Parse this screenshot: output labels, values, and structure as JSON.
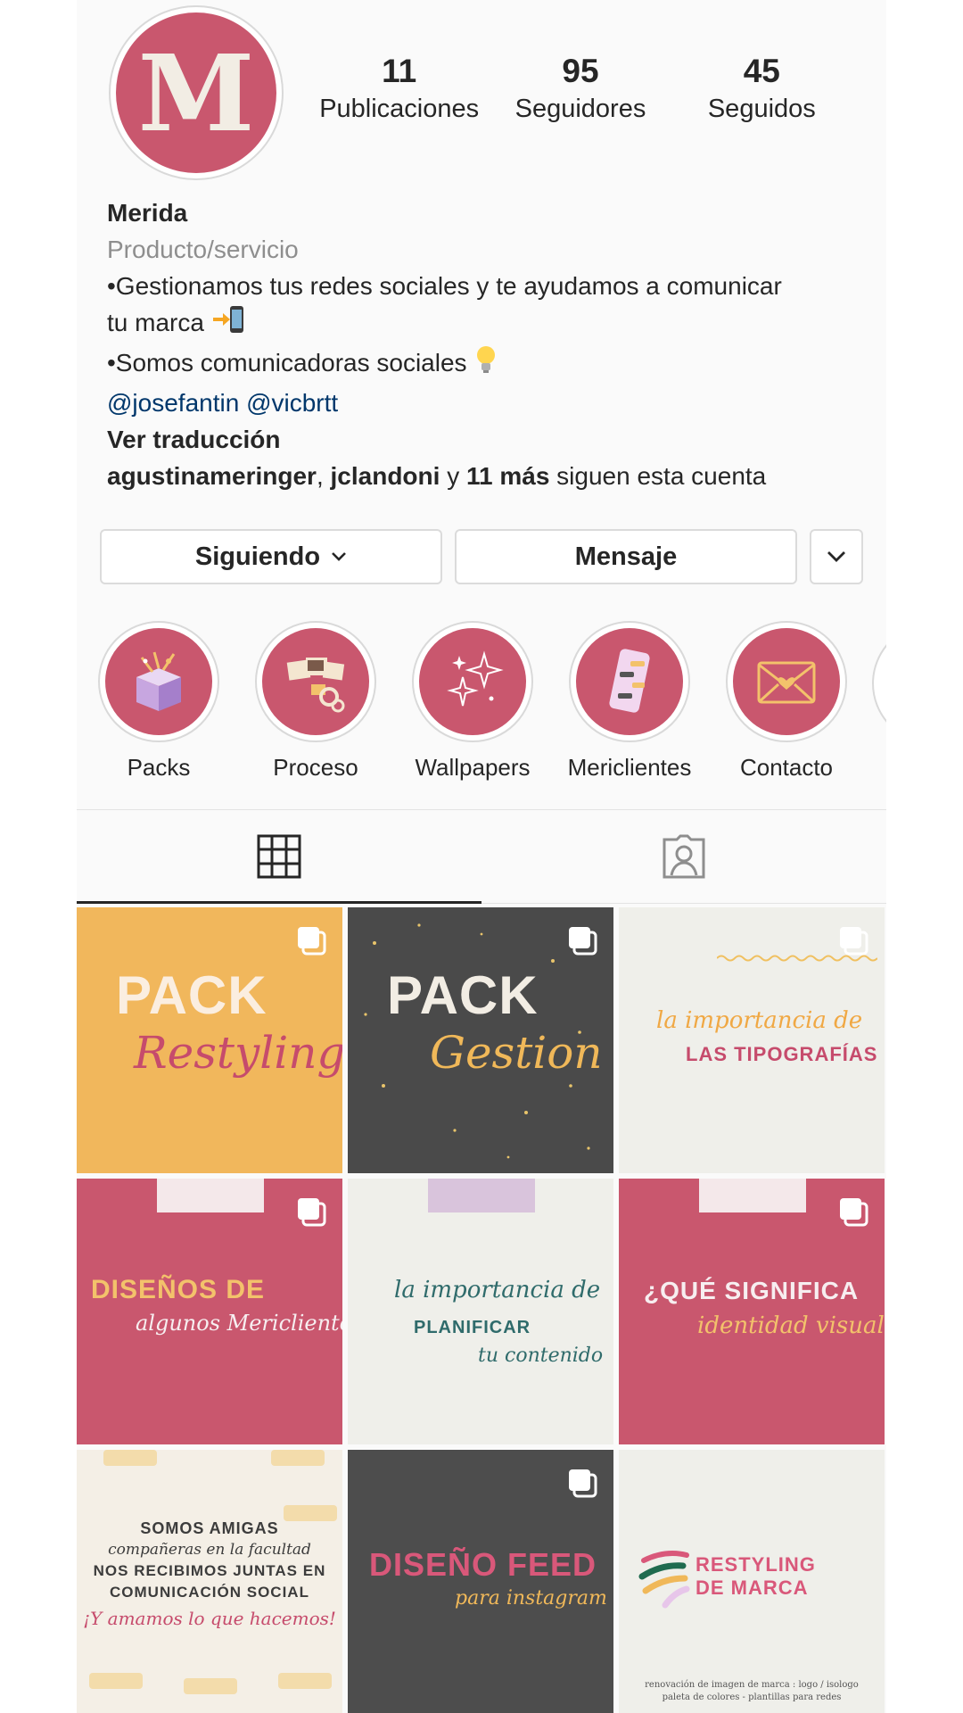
{
  "profile": {
    "avatar_letter": "M",
    "name": "Merida",
    "category": "Producto/servicio",
    "bio_line1": "•Gestionamos tus redes sociales y te ayudamos a comunicar",
    "bio_line2": "tu marca ",
    "bio_line3": "•Somos comunicadoras sociales ",
    "mention1": "@josefantin",
    "mention2": "@vicbrtt",
    "translate": "Ver traducción",
    "followed_user1": "agustinameringer",
    "followed_sep": ", ",
    "followed_user2": "jclandoni",
    "followed_and": " y ",
    "followed_more": "11 más",
    "followed_suffix": " siguen esta cuenta"
  },
  "stats": [
    {
      "value": "11",
      "label": "Publicaciones"
    },
    {
      "value": "95",
      "label": "Seguidores"
    },
    {
      "value": "45",
      "label": "Seguidos"
    }
  ],
  "buttons": {
    "following": "Siguiendo",
    "message": "Mensaje"
  },
  "highlights": [
    {
      "label": "Packs",
      "icon": "gift-box-icon"
    },
    {
      "label": "Proceso",
      "icon": "photos-gears-icon"
    },
    {
      "label": "Wallpapers",
      "icon": "sparkles-icon"
    },
    {
      "label": "Mericlientes",
      "icon": "phone-chat-icon"
    },
    {
      "label": "Contacto",
      "icon": "envelope-heart-icon"
    }
  ],
  "tabs": [
    {
      "name": "grid-icon",
      "active": true
    },
    {
      "name": "tagged-icon",
      "active": false
    }
  ],
  "posts": [
    {
      "line1": "PACK",
      "line2": "Restyling"
    },
    {
      "line1": "PACK",
      "line2": "Gestion"
    },
    {
      "line1": "la importancia de",
      "line2": "LAS TIPOGRAFÍAS"
    },
    {
      "line1": "DISEÑOS DE",
      "line2": "algunos Mericlientes"
    },
    {
      "line1": "la importancia de",
      "line2": "PLANIFICAR",
      "line3": "tu contenido"
    },
    {
      "line1": "¿QUÉ SIGNIFICA",
      "line2": "identidad visual?"
    },
    {
      "line1": "SOMOS AMIGAS",
      "line2": "compañeras en la facultad",
      "line3": "NOS RECIBIMOS JUNTAS EN",
      "line4": "COMUNICACIÓN SOCIAL",
      "line5": "¡Y amamos lo que hacemos!"
    },
    {
      "line1": "DISEÑO FEED",
      "line2": "para instagram"
    },
    {
      "line1": "RESTYLING",
      "line2": "DE MARCA",
      "line3": "renovación de imagen de marca : logo / isologo",
      "line4": "paleta de colores - plantillas para redes"
    }
  ],
  "colors": {
    "brand_pink": "#c9576e",
    "mention": "#00376b",
    "muted": "#8e8e8e"
  }
}
